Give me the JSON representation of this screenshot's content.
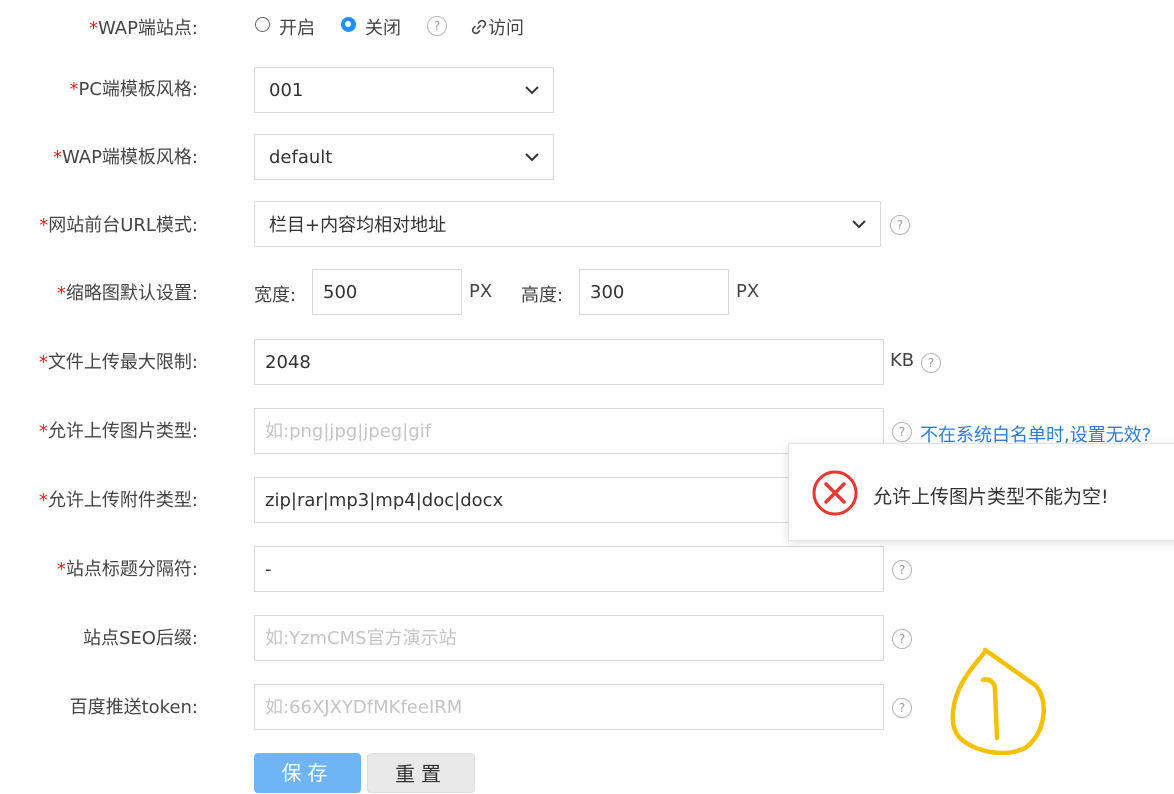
{
  "form": {
    "wap_site": {
      "required": "*",
      "label": "WAP端站点:",
      "option_on": "开启",
      "option_off": "关闭",
      "selected": "关闭",
      "help": "?",
      "visit_link": "访问"
    },
    "pc_template": {
      "required": "*",
      "label": "PC端模板风格:",
      "value": "001"
    },
    "wap_template": {
      "required": "*",
      "label": "WAP端模板风格:",
      "value": "default"
    },
    "url_mode": {
      "required": "*",
      "label": "网站前台URL模式:",
      "value": "栏目+内容均相对地址",
      "help": "?"
    },
    "thumb": {
      "required": "*",
      "label": "缩略图默认设置:",
      "width_label": "宽度:",
      "width_value": "500",
      "width_unit": "PX",
      "height_label": "高度:",
      "height_value": "300",
      "height_unit": "PX"
    },
    "upload_max": {
      "required": "*",
      "label": "文件上传最大限制:",
      "value": "2048",
      "unit": "KB",
      "help": "?"
    },
    "image_types": {
      "required": "*",
      "label": "允许上传图片类型:",
      "value": "",
      "placeholder": "如:png|jpg|jpeg|gif",
      "help": "?",
      "hint_link": "不在系统白名单时,设置无效?"
    },
    "attach_types": {
      "required": "*",
      "label": "允许上传附件类型:",
      "value": "zip|rar|mp3|mp4|doc|docx"
    },
    "title_sep": {
      "required": "*",
      "label": "站点标题分隔符:",
      "value": "-",
      "help": "?"
    },
    "seo_suffix": {
      "label": "站点SEO后缀:",
      "value": "",
      "placeholder": "如:YzmCMS官方演示站",
      "help": "?"
    },
    "baidu_token": {
      "label": "百度推送token:",
      "value": "",
      "placeholder": "如:66XJXYDfMKfeeIRM",
      "help": "?"
    }
  },
  "buttons": {
    "save": "保存",
    "reset": "重置"
  },
  "toast": {
    "message": "允许上传图片类型不能为空!",
    "icon": "error-icon"
  },
  "annotation": {
    "text": "1"
  },
  "colors": {
    "required": "#e02020",
    "accent": "#1e90ff",
    "link": "#2e7dd8",
    "error": "#e53935",
    "annotation": "#f5c000"
  }
}
